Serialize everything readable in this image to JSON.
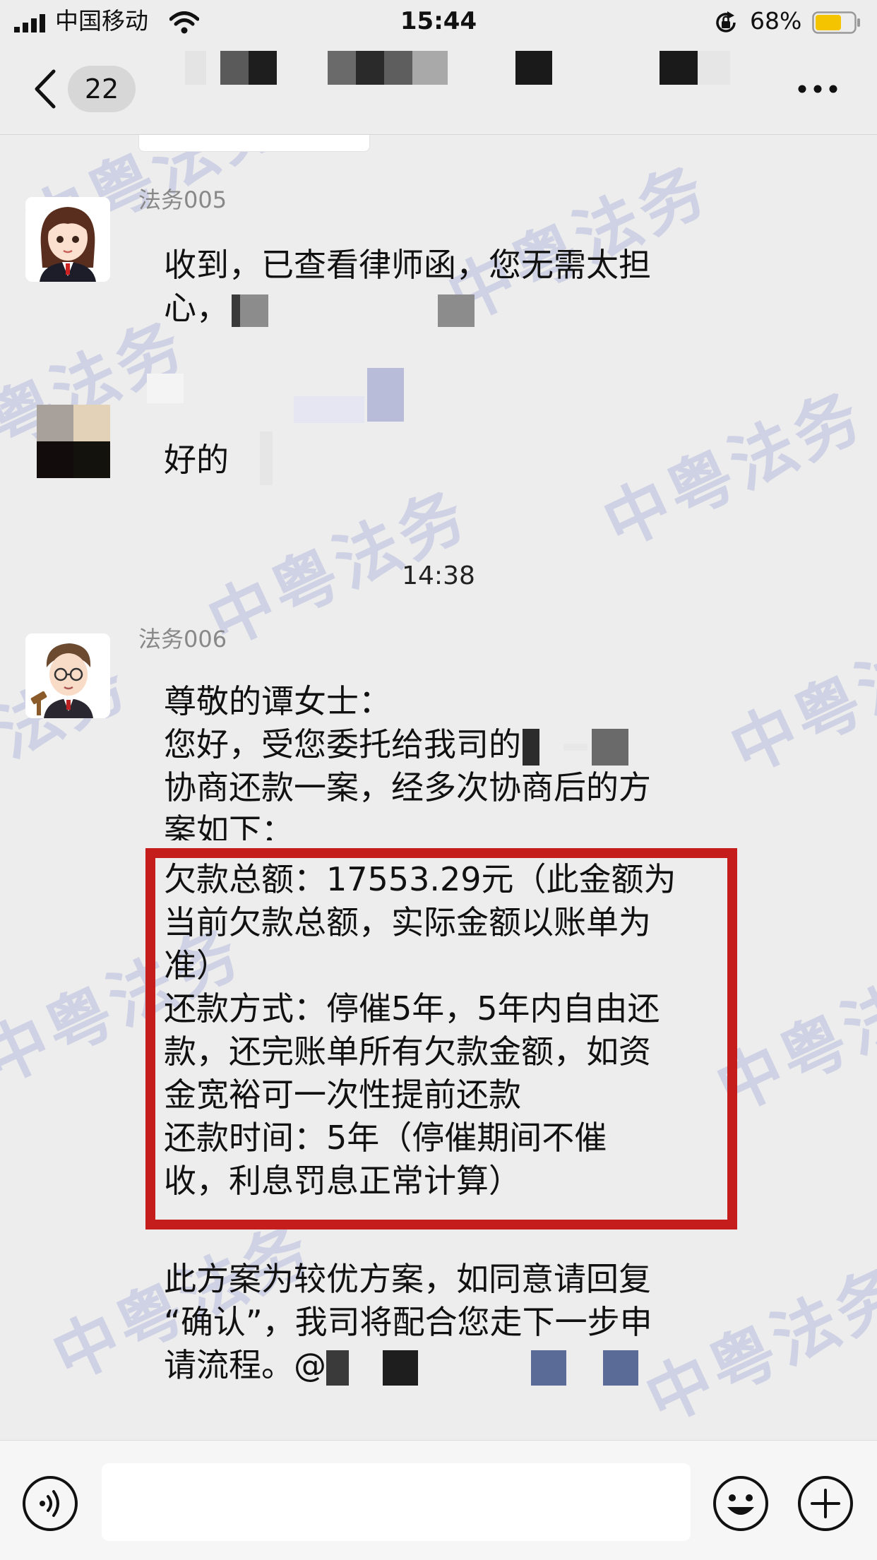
{
  "status_bar": {
    "carrier": "中国移动",
    "time": "15:44",
    "battery_percent": "68%",
    "battery_level": 0.68,
    "battery_color": "#f5c400"
  },
  "nav": {
    "unread_count": "22"
  },
  "watermark_text": "中粤法务",
  "messages": [
    {
      "sender": "法务005",
      "lines": [
        "收到，已查看律师函，您无需太担",
        "心，"
      ]
    },
    {
      "sender": "",
      "lines": [
        "好的"
      ]
    }
  ],
  "timestamp": "14:38",
  "long_message": {
    "sender": "法务006",
    "intro_lines": [
      "尊敬的谭女士：",
      "您好，受您委托给我司的",
      "协商还款一案，经多次协商后的方",
      "案如下："
    ],
    "boxed_lines": [
      "欠款总额：17553.29元（此金额为",
      "当前欠款总额，实际金额以账单为",
      "准）",
      "还款方式：停催5年，5年内自由还",
      "款，还完账单所有欠款金额，如资",
      "金宽裕可一次性提前还款",
      "还款时间：5年（停催期间不催",
      "收，利息罚息正常计算）"
    ],
    "outro_lines": [
      "此方案为较优方案，如同意请回复",
      "“确认”，我司将配合您走下一步申",
      "请流程。@"
    ]
  },
  "colors": {
    "highlight_border": "#c51c1c",
    "background": "#ededed"
  }
}
